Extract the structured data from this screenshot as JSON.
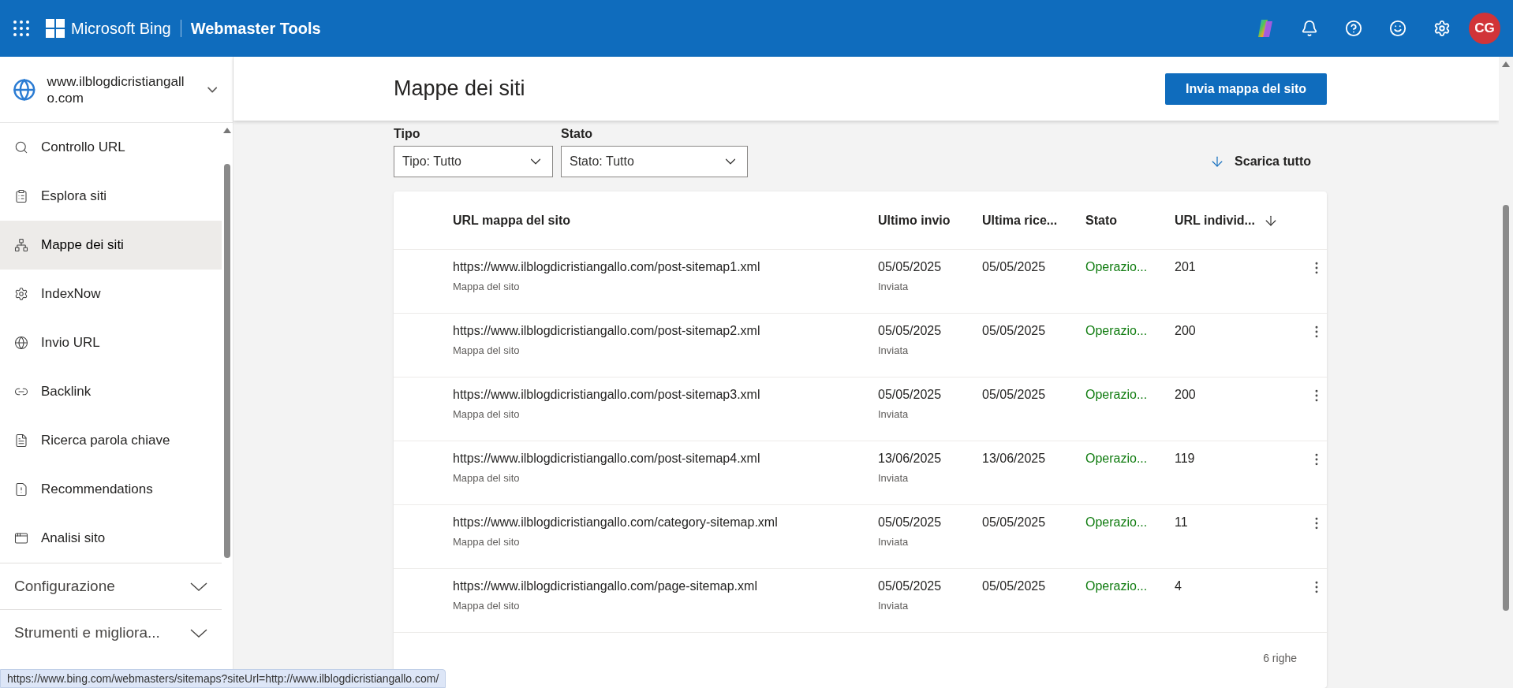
{
  "topbar": {
    "brand": "Microsoft Bing",
    "product": "Webmaster Tools",
    "avatar": "CG"
  },
  "site": {
    "name": "www.ilblogdicristiangallo.com"
  },
  "sidebar": {
    "items": [
      {
        "label": "Controllo URL",
        "selected": false
      },
      {
        "label": "Esplora siti",
        "selected": false
      },
      {
        "label": "Mappe dei siti",
        "selected": true
      },
      {
        "label": "IndexNow",
        "selected": false
      },
      {
        "label": "Invio URL",
        "selected": false
      },
      {
        "label": "Backlink",
        "selected": false
      },
      {
        "label": "Ricerca parola chiave",
        "selected": false
      },
      {
        "label": "Recommendations",
        "selected": false
      },
      {
        "label": "Analisi sito",
        "selected": false
      }
    ],
    "sections": [
      {
        "label": "Configurazione",
        "expanded": false
      },
      {
        "label": "Strumenti e migliora...",
        "expanded": false
      }
    ]
  },
  "page": {
    "title": "Mappe dei siti",
    "primary_button": "Invia mappa del sito"
  },
  "filters": [
    {
      "label": "Tipo",
      "value": "Tipo: Tutto"
    },
    {
      "label": "Stato",
      "value": "Stato: Tutto"
    }
  ],
  "download_button": "Scarica tutto",
  "table": {
    "columns": [
      {
        "label": "URL mappa del sito",
        "sorted": false
      },
      {
        "label": "Ultimo invio",
        "sorted": false
      },
      {
        "label": "Ultima rice...",
        "sorted": false
      },
      {
        "label": "Stato",
        "sorted": false
      },
      {
        "label": "URL individ...",
        "sorted": true
      }
    ],
    "rows": [
      {
        "url": "https://www.ilblogdicristiangallo.com/post-sitemap1.xml",
        "type": "Mappa del sito",
        "last_submitted": "05/05/2025",
        "submit_note": "Inviata",
        "last_received": "05/05/2025",
        "status": "Operazio...",
        "urls": "201"
      },
      {
        "url": "https://www.ilblogdicristiangallo.com/post-sitemap2.xml",
        "type": "Mappa del sito",
        "last_submitted": "05/05/2025",
        "submit_note": "Inviata",
        "last_received": "05/05/2025",
        "status": "Operazio...",
        "urls": "200"
      },
      {
        "url": "https://www.ilblogdicristiangallo.com/post-sitemap3.xml",
        "type": "Mappa del sito",
        "last_submitted": "05/05/2025",
        "submit_note": "Inviata",
        "last_received": "05/05/2025",
        "status": "Operazio...",
        "urls": "200"
      },
      {
        "url": "https://www.ilblogdicristiangallo.com/post-sitemap4.xml",
        "type": "Mappa del sito",
        "last_submitted": "13/06/2025",
        "submit_note": "Inviata",
        "last_received": "13/06/2025",
        "status": "Operazio...",
        "urls": "119"
      },
      {
        "url": "https://www.ilblogdicristiangallo.com/category-sitemap.xml",
        "type": "Mappa del sito",
        "last_submitted": "05/05/2025",
        "submit_note": "Inviata",
        "last_received": "05/05/2025",
        "status": "Operazio...",
        "urls": "11"
      },
      {
        "url": "https://www.ilblogdicristiangallo.com/page-sitemap.xml",
        "type": "Mappa del sito",
        "last_submitted": "05/05/2025",
        "submit_note": "Inviata",
        "last_received": "05/05/2025",
        "status": "Operazio...",
        "urls": "4"
      }
    ],
    "row_count": "6 righe"
  },
  "status_bar": {
    "url": "https://www.bing.com/webmasters/sitemaps?siteUrl=http://www.ilblogdicristiangallo.com/"
  }
}
